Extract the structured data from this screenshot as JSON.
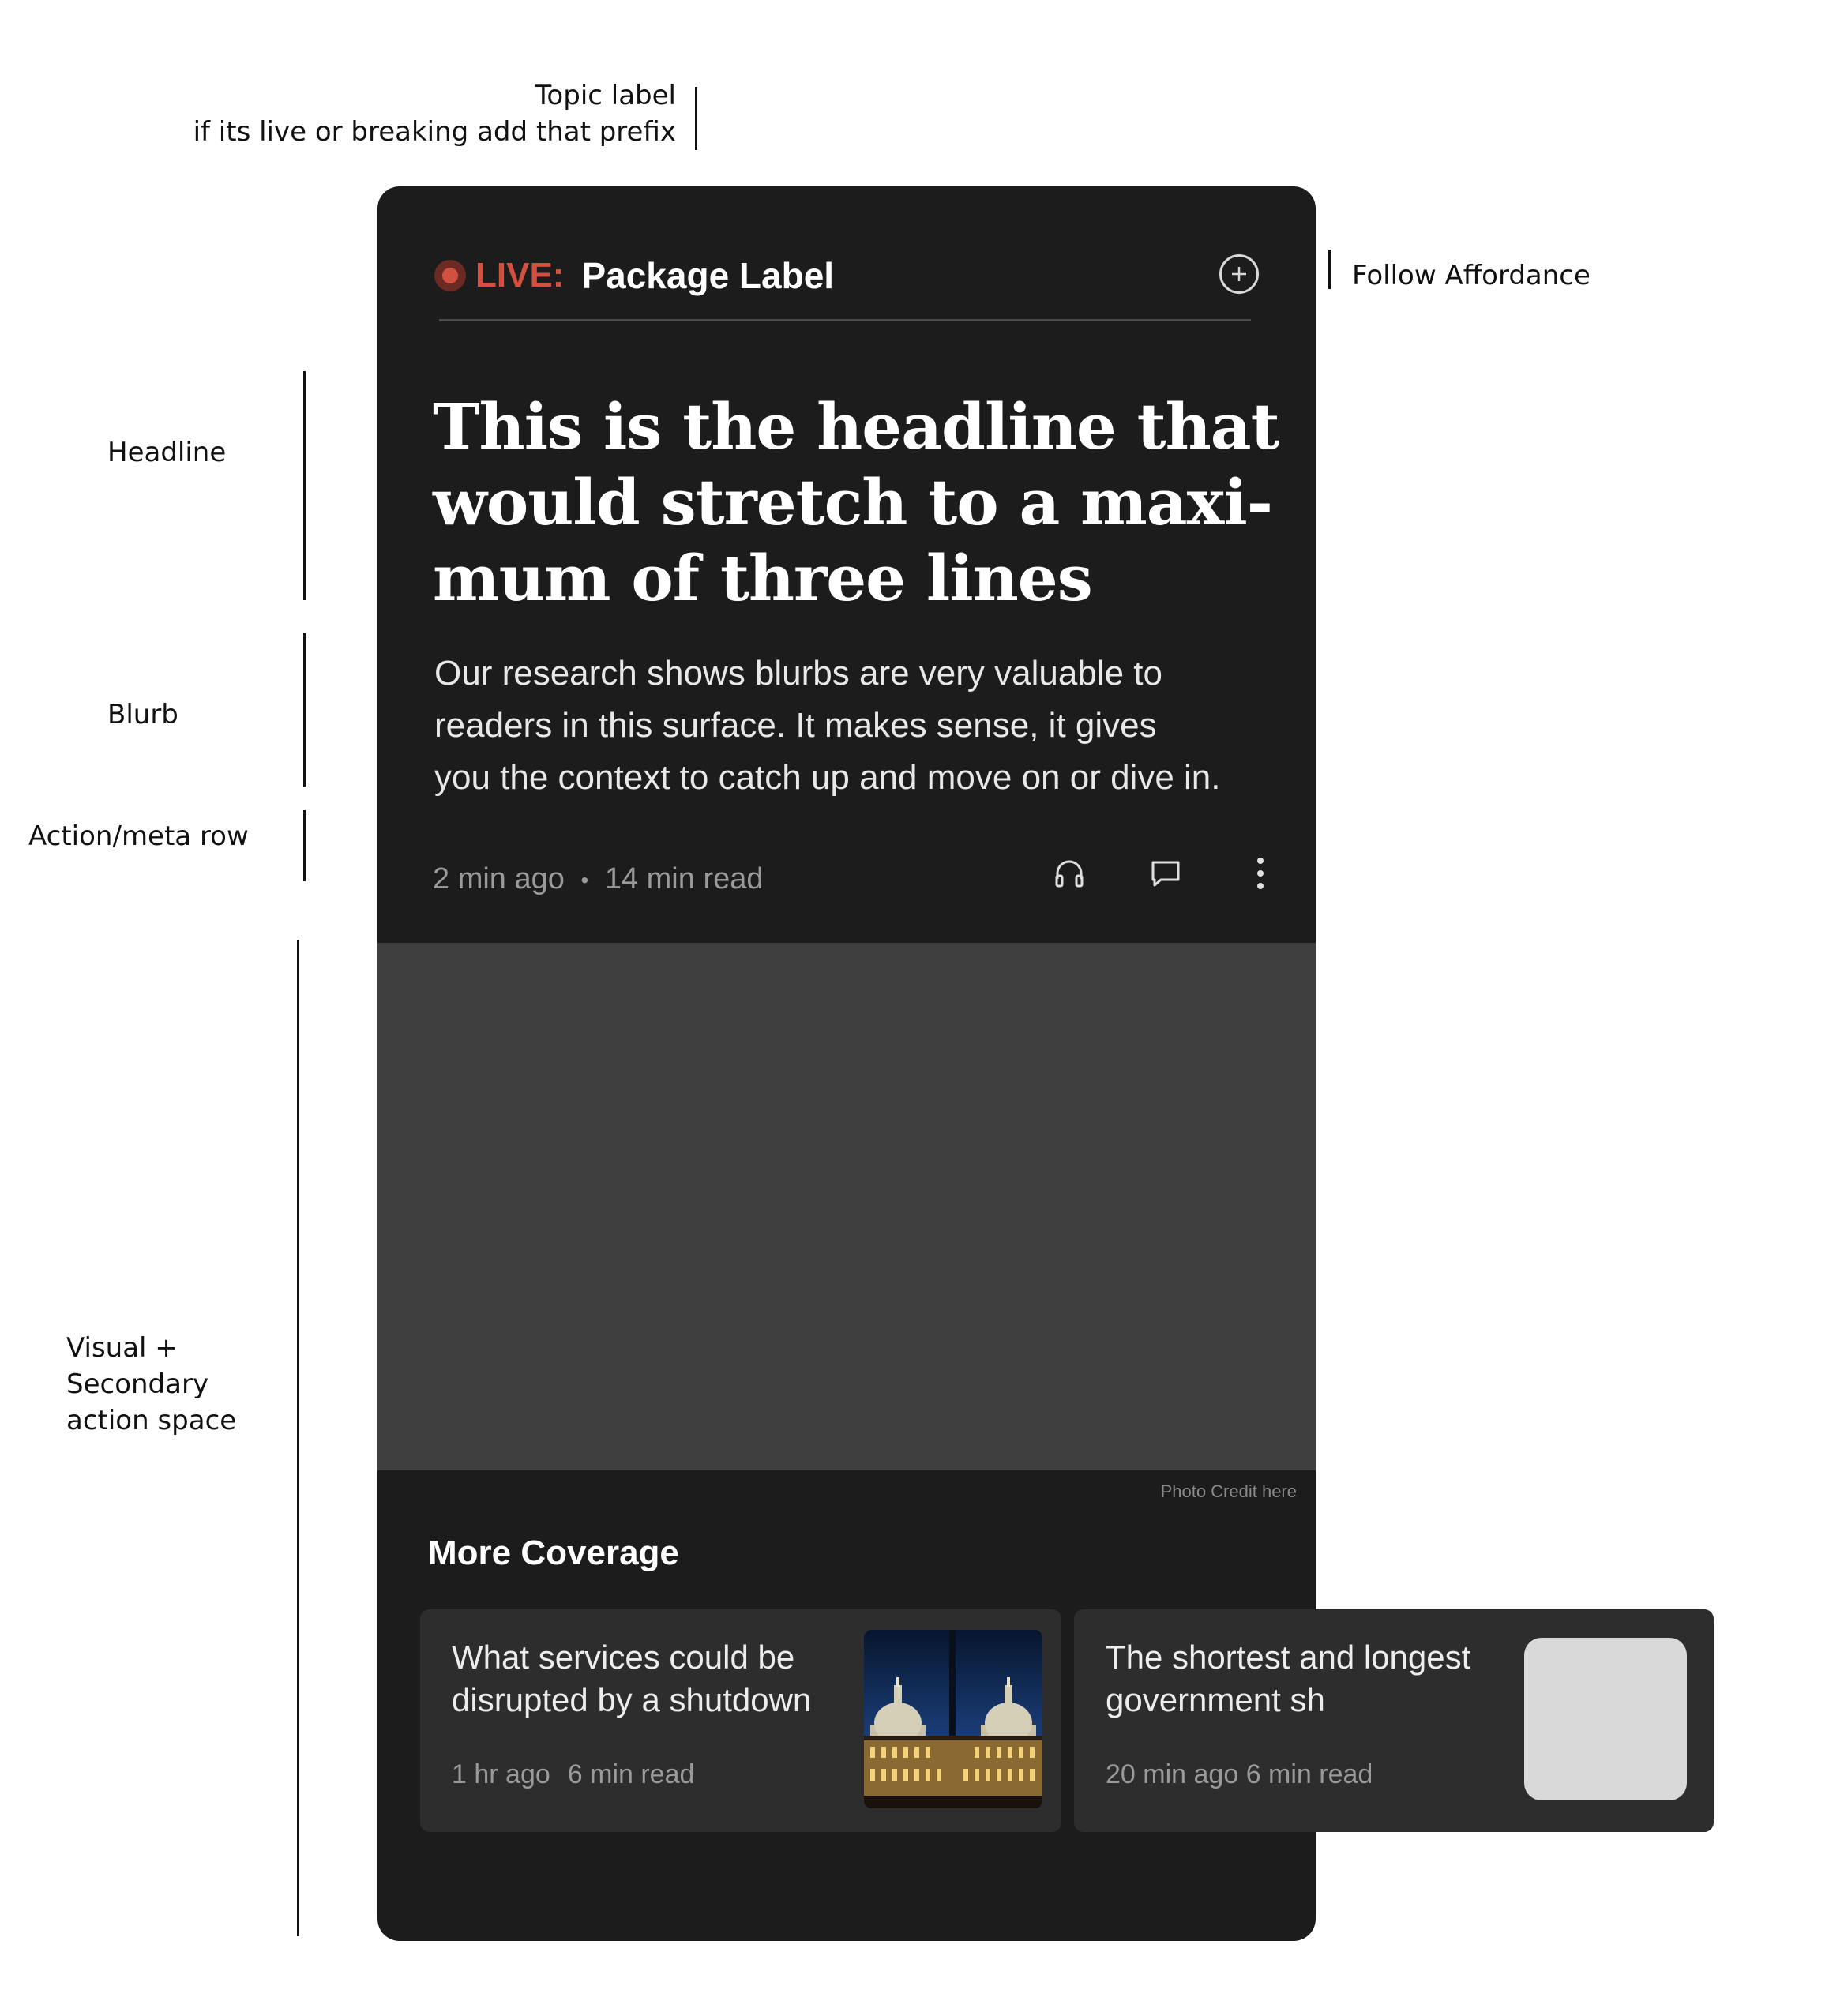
{
  "annotations": {
    "topic_label": "Topic label\nif its live or breaking add that  prefix",
    "follow": "Follow Affordance",
    "headline": "Headline",
    "blurb": "Blurb",
    "meta_row": "Action/meta row",
    "visual": "Visual +\nSecondary\naction space"
  },
  "card": {
    "live_prefix": "LIVE:",
    "package_label": "Package Label",
    "headline_lines": [
      "This is the headline that",
      "would stretch to a maxi-",
      "mum of three lines"
    ],
    "blurb_lines": [
      "Our research shows  blurbs are very valuable to",
      "readers in this surface.  It makes sense, it gives",
      "you the context to catch up and move on or dive in."
    ],
    "meta_time": "2 min ago",
    "meta_separator": "•",
    "meta_read": "14 min read",
    "icons": {
      "follow": "plus-circle-icon",
      "listen": "headphones-icon",
      "comment": "comment-icon",
      "more": "more-vertical-icon"
    },
    "photo_credit": "Photo Credit here",
    "more_coverage": "More Coverage"
  },
  "stories": [
    {
      "title_lines": [
        "What services could be",
        "disrupted by a shutdown"
      ],
      "time": "1 hr ago",
      "read": "6 min read",
      "thumbnail": "capitol-building-night"
    },
    {
      "title_lines": [
        "The shortest and longest",
        "government sh"
      ],
      "time": "20 min ago",
      "read": "6 min read",
      "thumbnail": "placeholder"
    }
  ],
  "colors": {
    "card_bg": "#1c1c1c",
    "visual_bg": "#3f3f3f",
    "live_red": "#d2503f",
    "story_card_bg": "#2d2d2d",
    "placeholder": "#d9d9d9"
  }
}
